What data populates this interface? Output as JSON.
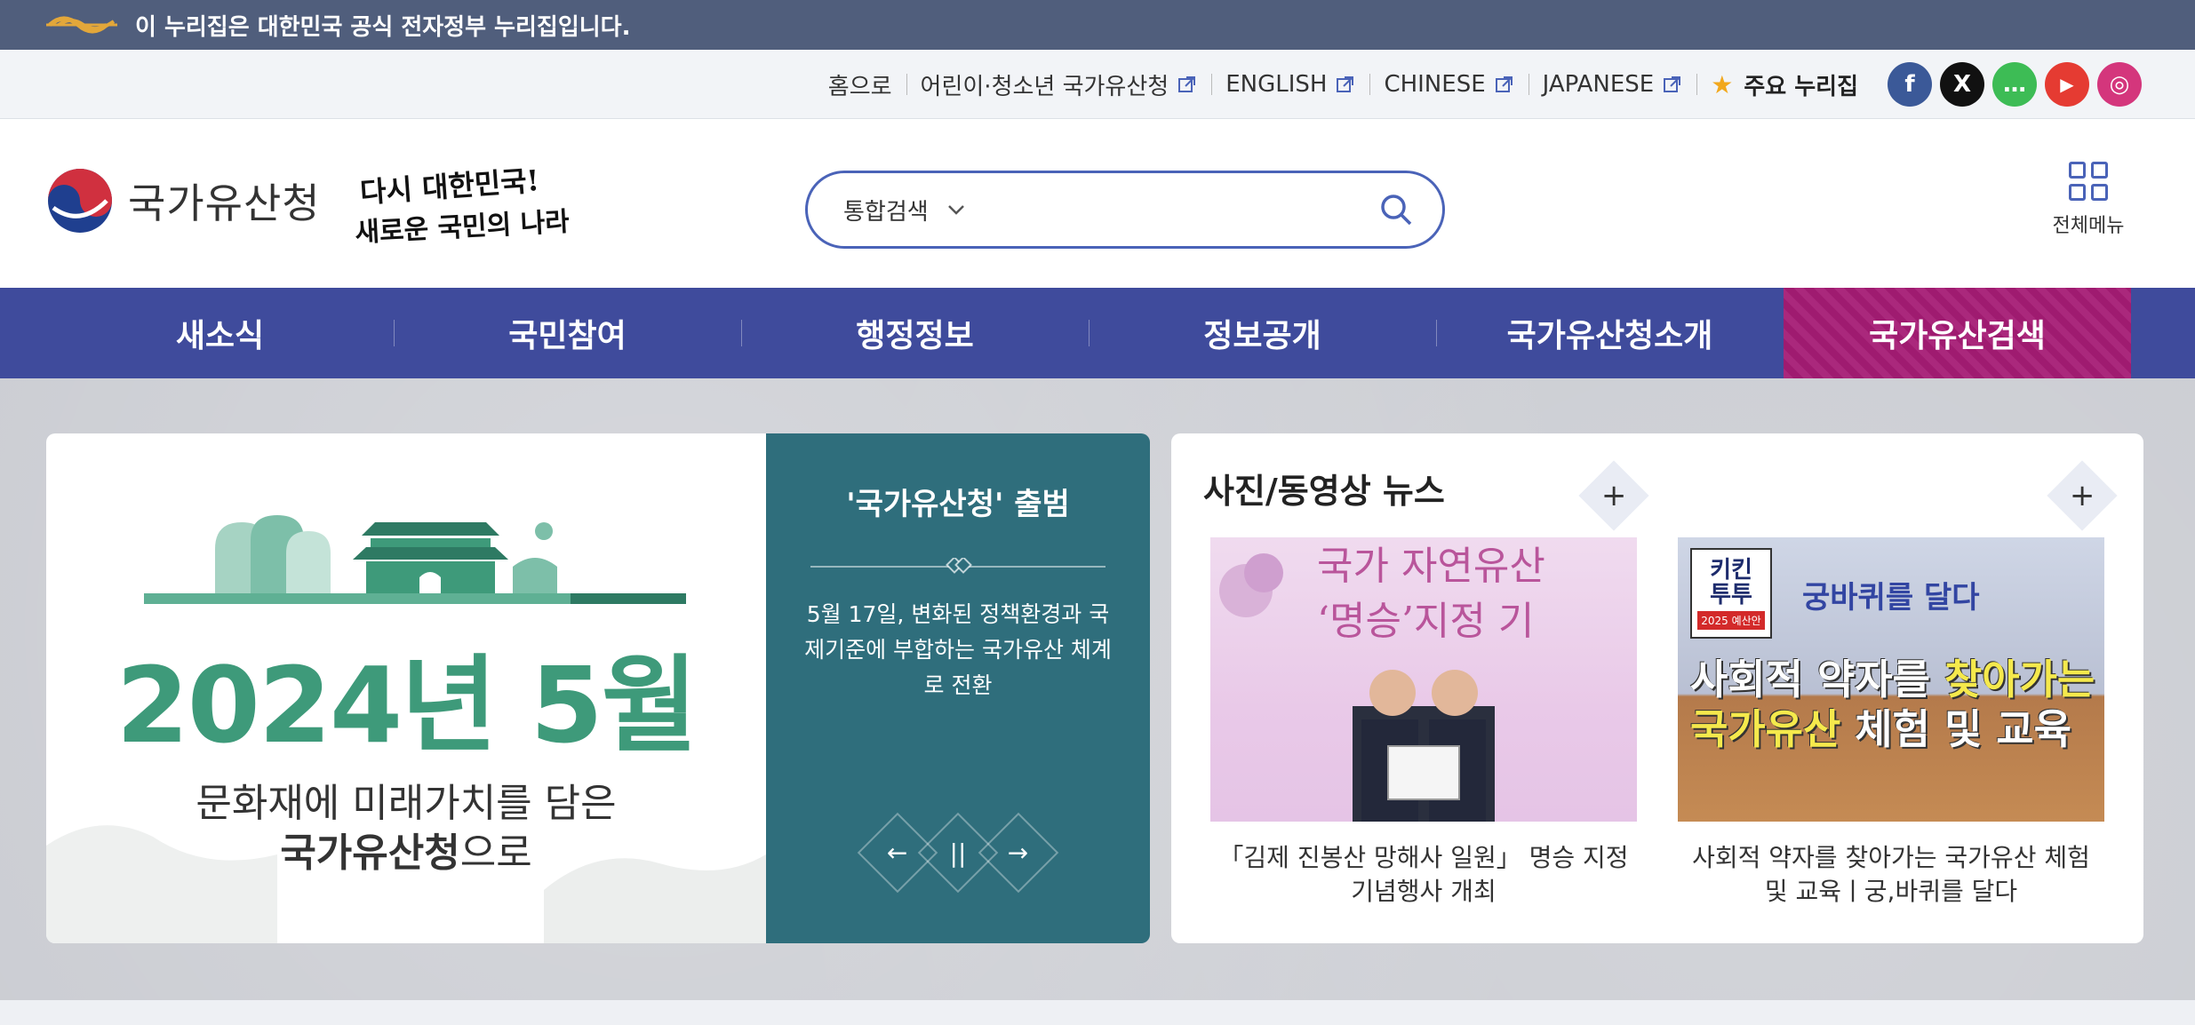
{
  "gov_banner": {
    "text": "이 누리집은 대한민국 공식 전자정부 누리집입니다."
  },
  "utility": {
    "links": [
      {
        "label": "홈으로",
        "external": false
      },
      {
        "label": "어린이·청소년 국가유산청",
        "external": true
      },
      {
        "label": "ENGLISH",
        "external": true
      },
      {
        "label": "CHINESE",
        "external": true
      },
      {
        "label": "JAPANESE",
        "external": true
      }
    ],
    "key_sites": "주요 누리집",
    "sns": [
      {
        "name": "facebook-icon",
        "glyph": "f",
        "color": "#3b5998"
      },
      {
        "name": "x-icon",
        "glyph": "X",
        "color": "#111111"
      },
      {
        "name": "talk-icon",
        "glyph": "…",
        "color": "#3dbc55"
      },
      {
        "name": "youtube-icon",
        "glyph": "▶",
        "color": "#e53b32"
      },
      {
        "name": "instagram-icon",
        "glyph": "◎",
        "color": "#d4367c"
      }
    ]
  },
  "header": {
    "brand_name": "국가유산청",
    "slogan_line1": "다시 대한민국!",
    "slogan_line2": "새로운 국민의 나라",
    "search_scope": "통합검색",
    "search_placeholder": "",
    "all_menu_label": "전체메뉴"
  },
  "gnb": {
    "items": [
      "새소식",
      "국민참여",
      "행정정보",
      "정보공개",
      "국가유산청소개",
      "국가유산검색"
    ],
    "highlight_color": "#a51c75"
  },
  "main_banner": {
    "year_month": "2024년 5월",
    "line1": "문화재에 미래가치를 담은",
    "line2_bold": "국가유산청",
    "line2_rest": "으로",
    "side_title": "'국가유산청' 출범",
    "side_desc": "5월 17일, 변화된 정책환경과 국제기준에 부합하는 국가유산 체계로 전환",
    "controls": {
      "prev": "←",
      "pause": "||",
      "next": "→"
    }
  },
  "news": {
    "title": "사진/동영상 뉴스",
    "more_label": "+",
    "cards": [
      {
        "thumb_text_line1": "국가 자연유산",
        "thumb_text_line2": "‘명승’지정 기",
        "caption": "「김제 진봉산 망해사 일원」 명승 지정 기념행사 개최"
      },
      {
        "badge_line1": "키킨",
        "badge_line2": "투투",
        "badge_tag": "2025 예산안",
        "thumb_top": "궁바퀴를 달다",
        "thumb_big_1a": "사회적 약자를 ",
        "thumb_big_1b": "찾아가는",
        "thumb_big_2a": "국가유산",
        "thumb_big_2b": " 체험 및 교육",
        "caption": "사회적 약자를 찾아가는 국가유산 체험 및 교육ㅣ궁,바퀴를 달다"
      }
    ]
  }
}
